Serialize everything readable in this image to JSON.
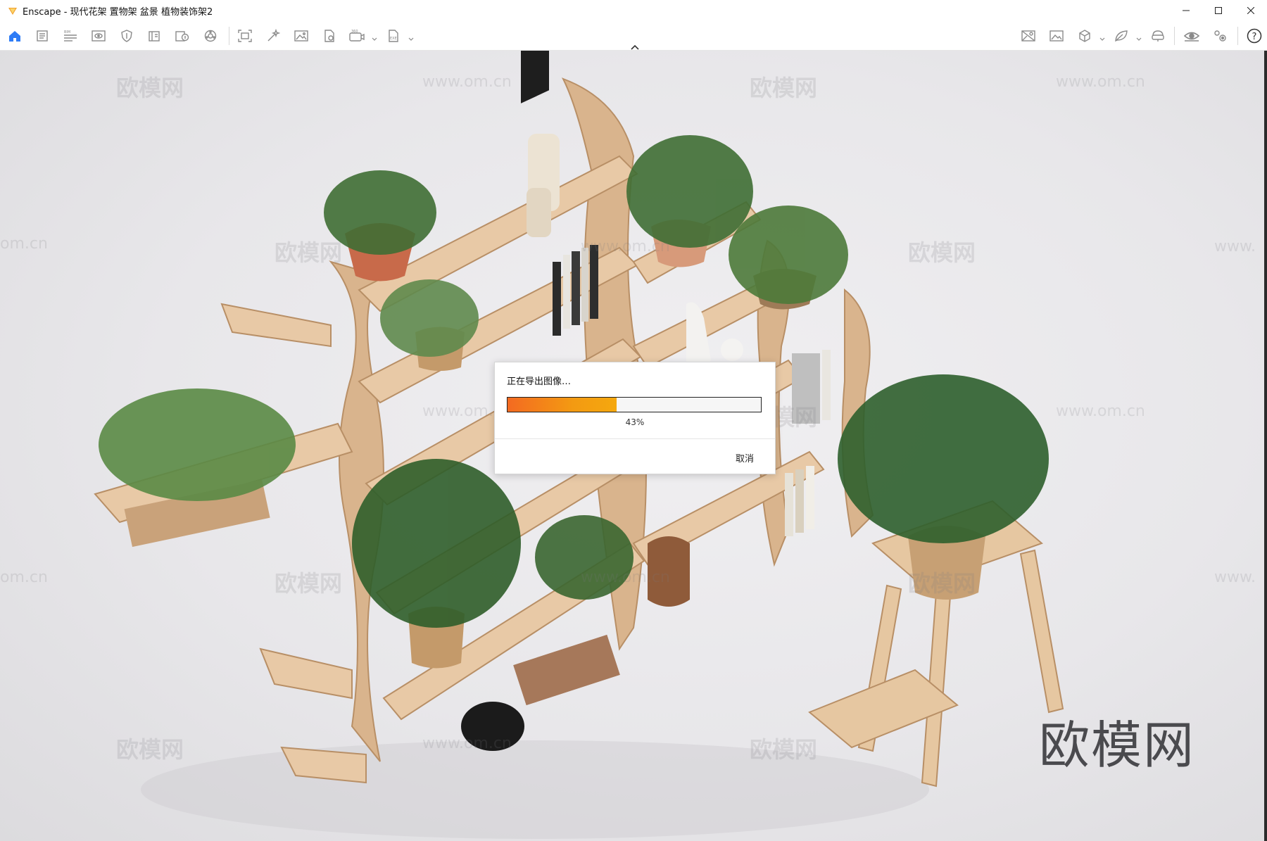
{
  "window": {
    "title": "Enscape - 现代花架 置物架 盆景 植物装饰架2",
    "controls": [
      "minimize-icon",
      "maximize-icon",
      "close-icon"
    ]
  },
  "toolbar": {
    "left_icons": [
      "home-icon",
      "document-icon",
      "bim-icon",
      "visual-settings-icon",
      "shield-icon",
      "library-icon",
      "asset-icon",
      "material-icon",
      "capture-frame-icon",
      "magic-wand-icon",
      "image-icon",
      "file-export-icon",
      "video-360-icon",
      "exe-export-icon"
    ],
    "right_icons": [
      "map-icon",
      "screenshot-icon",
      "cube-icon",
      "leaf-icon",
      "vr-headset-icon",
      "eye-icon",
      "settings-icon",
      "help-icon"
    ],
    "accent": "#2e7cf6"
  },
  "watermarks": {
    "logo_text": "欧模网",
    "site_text": "www.om.cn",
    "site_short": "om.cn",
    "site_prefix": "www."
  },
  "dialog": {
    "message": "正在导出图像…",
    "progress_percent": 43,
    "progress_label": "43%",
    "cancel_label": "取消"
  }
}
